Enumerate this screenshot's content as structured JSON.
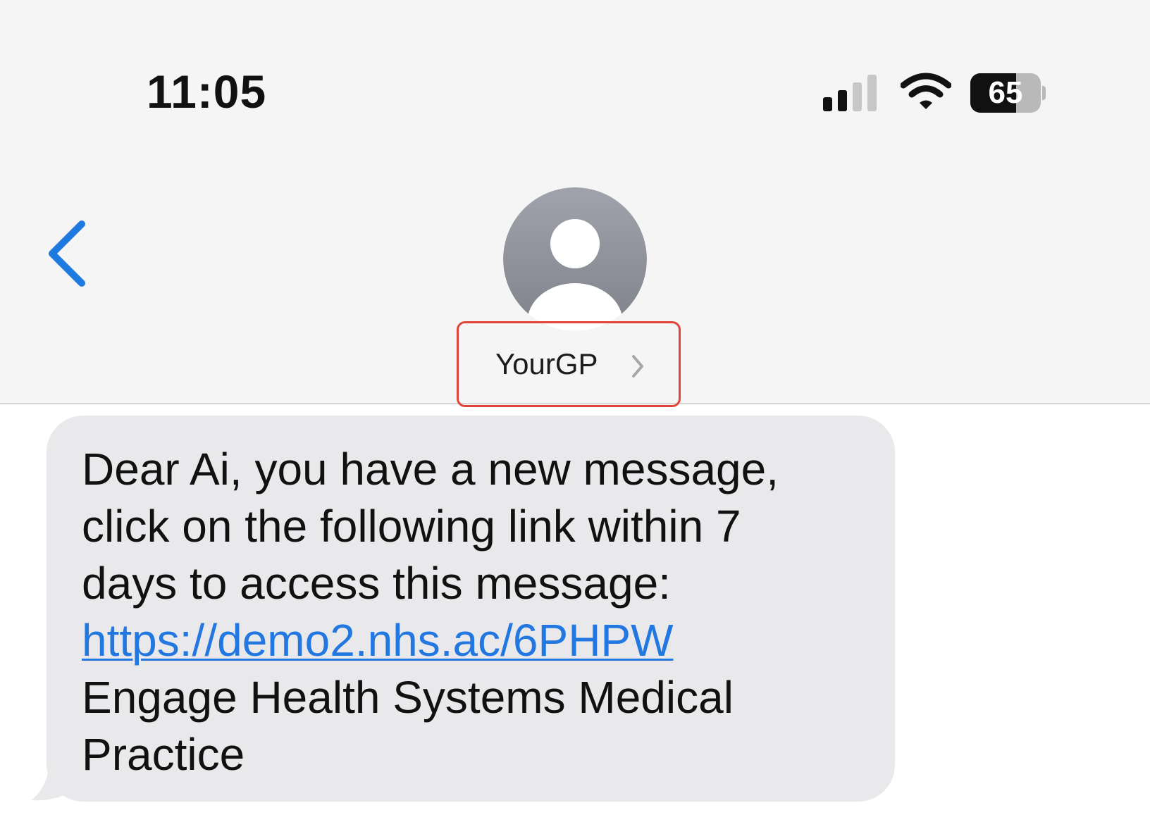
{
  "status_bar": {
    "time": "11:05",
    "battery_level": "65",
    "battery_fraction": 0.65,
    "signal_bars_active": 2,
    "signal_bars_total": 4,
    "icons": [
      "signal-icon",
      "wifi-icon",
      "battery-icon"
    ]
  },
  "header": {
    "back_icon": "chevron-left-icon",
    "avatar_icon": "person-silhouette-icon",
    "contact_name": "YourGP",
    "contact_chevron_icon": "chevron-right-icon"
  },
  "message": {
    "line_1": "Dear Ai, you have a new message,",
    "line_2": "click on the following link within 7",
    "line_3": "days to access this message:",
    "link": "https://demo2.nhs.ac/6PHPW",
    "line_5": "Engage Health Systems Medical",
    "line_6": "Practice"
  },
  "colors": {
    "accent_blue": "#1f7ae0",
    "highlight_red": "#e0443a",
    "bubble_gray": "#e9e9eb",
    "header_gray": "#f5f5f5"
  }
}
